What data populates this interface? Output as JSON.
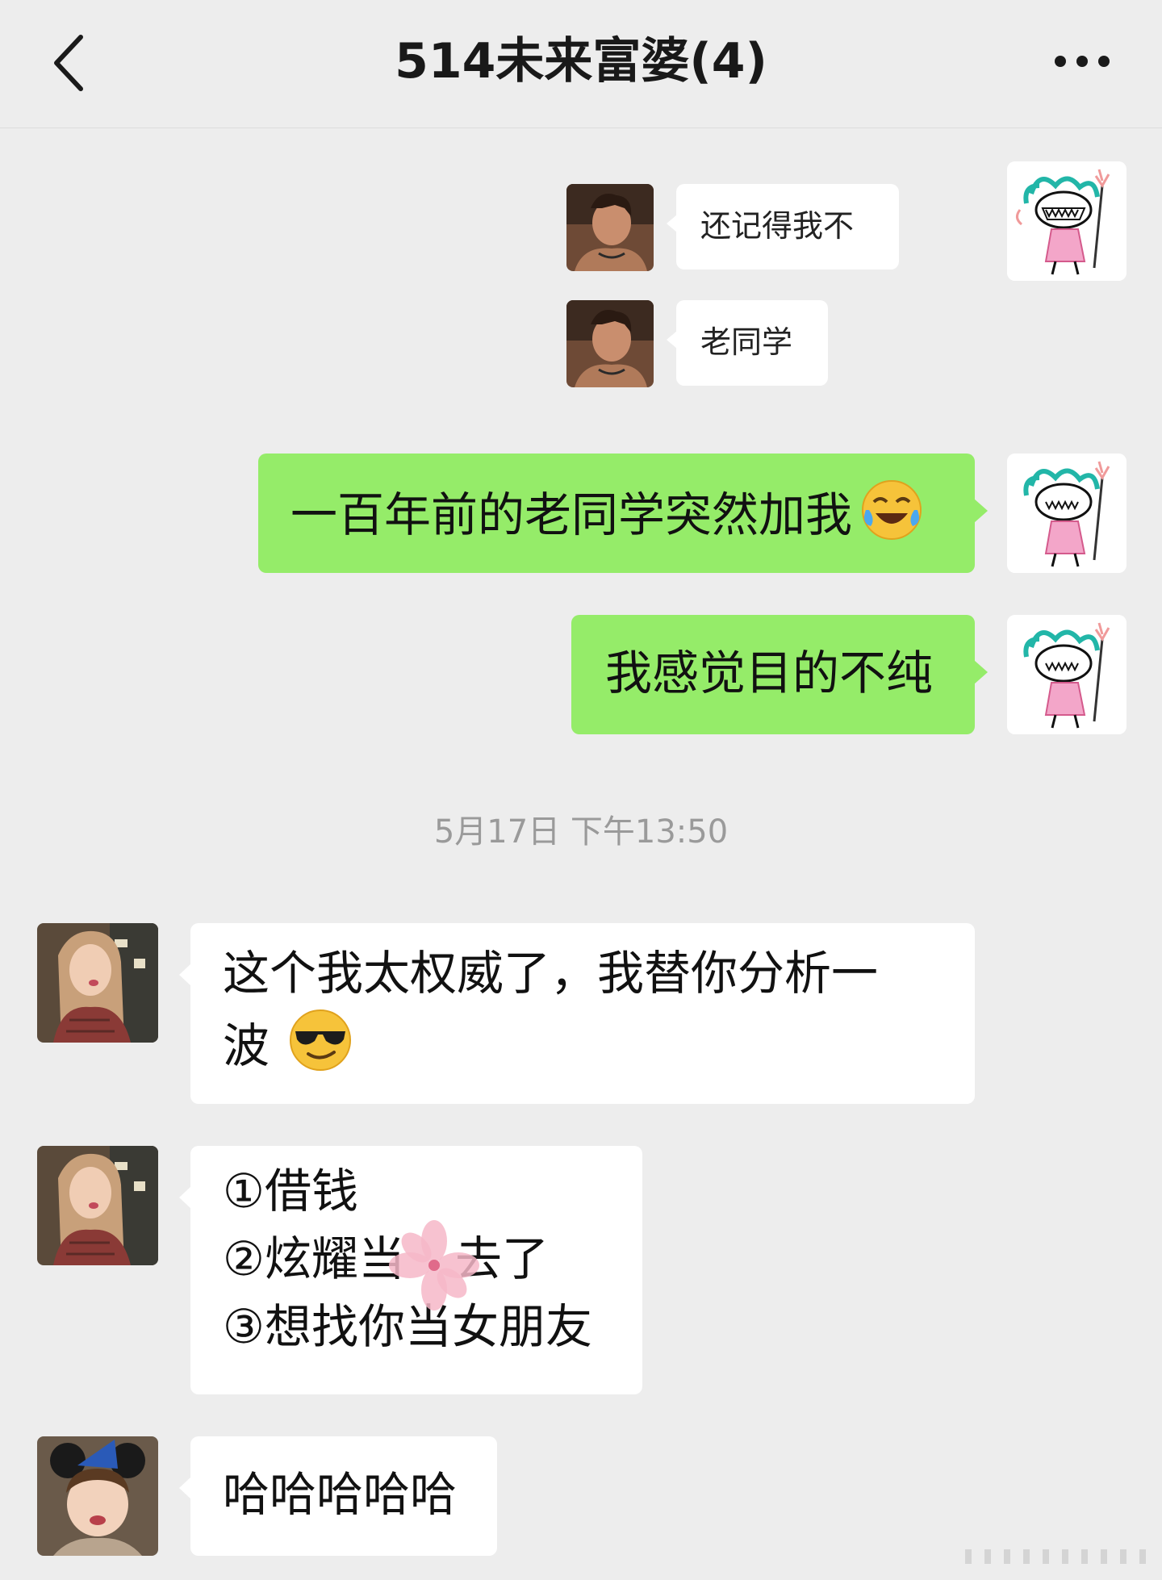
{
  "header": {
    "title": "514未来富婆(4)",
    "back_icon": "chevron-left-icon",
    "more_icon": "more-dots-icon"
  },
  "quoted_card": {
    "messages": [
      {
        "text": "还记得我不",
        "avatar": "male-avatar"
      },
      {
        "text": "老同学",
        "avatar": "male-avatar"
      }
    ]
  },
  "messages": [
    {
      "side": "right",
      "text": "一百年前的老同学突然加我",
      "emoji": "laughing-crying-face-icon"
    },
    {
      "side": "right",
      "text": "我感觉目的不纯"
    }
  ],
  "timestamp": "5月17日 下午13:50",
  "incoming": [
    {
      "line1": "这个我太权威了，我替你分析一",
      "line2": "波",
      "emoji": "sunglasses-face-icon",
      "avatar": "girl-avatar"
    },
    {
      "lines": [
        "①借钱",
        "②炫耀当",
        "去了",
        "③想找你当女朋友"
      ],
      "avatar": "girl-avatar",
      "overlay": "sakura-flower-sticker"
    },
    {
      "text": "哈哈哈哈哈",
      "avatar": "child-avatar"
    }
  ],
  "colors": {
    "background": "#ededed",
    "self_bubble": "#95ec69",
    "other_bubble": "#ffffff",
    "timestamp": "#9a9a9a"
  }
}
